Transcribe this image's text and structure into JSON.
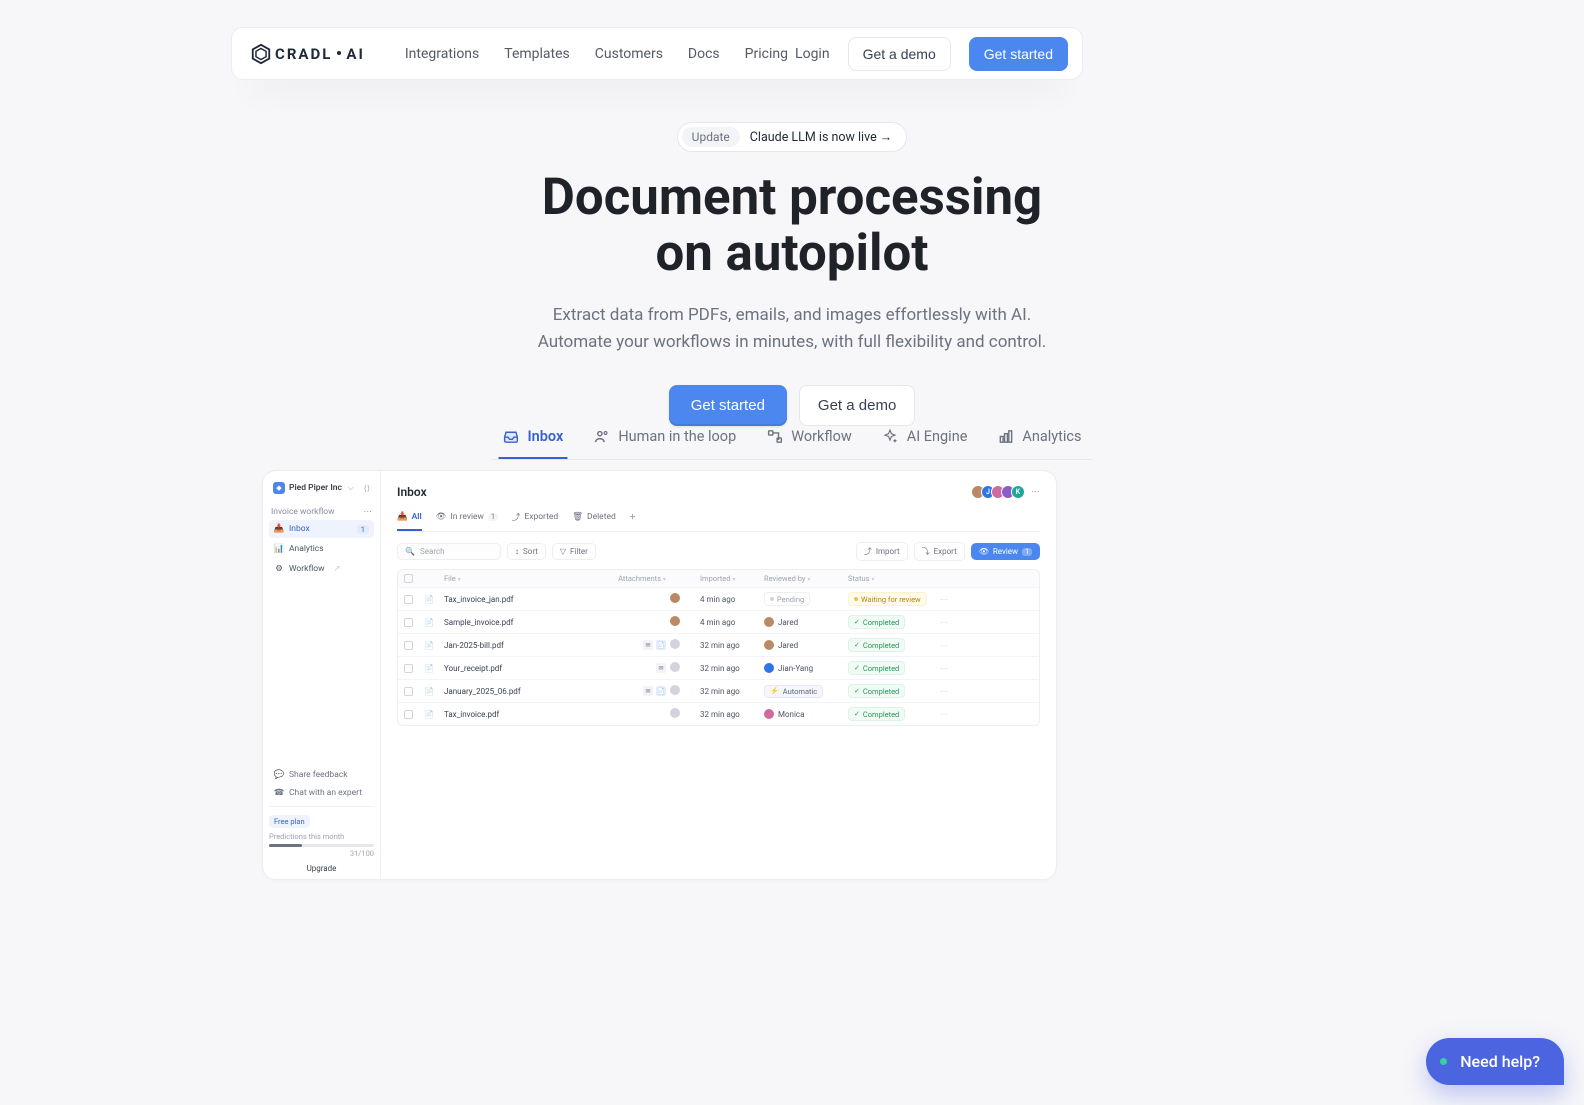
{
  "nav": {
    "brand_a": "CRADL",
    "brand_b": "AI",
    "links": [
      "Integrations",
      "Templates",
      "Customers",
      "Docs",
      "Pricing"
    ],
    "login": "Login",
    "demo": "Get a demo",
    "start": "Get started"
  },
  "update": {
    "badge": "Update",
    "text": "Claude LLM is now live →"
  },
  "hero": {
    "title_a": "Document processing",
    "title_b": "on autopilot",
    "sub_a": "Extract data from PDFs, emails, and images effortlessly with AI.",
    "sub_b": "Automate your workflows in minutes, with full flexibility and control.",
    "cta_primary": "Get started",
    "cta_secondary": "Get a demo"
  },
  "feature_tabs": [
    "Inbox",
    "Human in the loop",
    "Workflow",
    "AI Engine",
    "Analytics"
  ],
  "app": {
    "org": "Pied Piper Inc",
    "section": "Invoice workflow",
    "items": [
      {
        "label": "Inbox",
        "badge": "1",
        "active": true
      },
      {
        "label": "Analytics"
      },
      {
        "label": "Workflow"
      }
    ],
    "foot": [
      {
        "label": "Share feedback"
      },
      {
        "label": "Chat with an expert"
      }
    ],
    "plan": {
      "pill": "Free plan",
      "label": "Predictions this month",
      "count": "31/100",
      "upgrade": "Upgrade"
    },
    "main": {
      "title": "Inbox",
      "avatars": [
        {
          "bg": "#b98a65",
          "t": ""
        },
        {
          "bg": "#2f74e8",
          "t": "J"
        },
        {
          "bg": "#cf6aa0",
          "t": ""
        },
        {
          "bg": "#8c5cc9",
          "t": ""
        },
        {
          "bg": "#1fa796",
          "t": "K"
        }
      ],
      "tabs": [
        {
          "label": "All",
          "active": true
        },
        {
          "label": "In review",
          "count": "1"
        },
        {
          "label": "Exported"
        },
        {
          "label": "Deleted"
        }
      ],
      "search_ph": "Search",
      "sort": "Sort",
      "filter": "Filter",
      "import": "Import",
      "export": "Export",
      "review": "Review",
      "review_count": "1",
      "cols": {
        "file": "File",
        "attachments": "Attachments",
        "imported": "Imported",
        "reviewed": "Reviewed by",
        "status": "Status"
      },
      "rows": [
        {
          "file": "Tax_invoice_jan.pdf",
          "att": [],
          "imp_av": "#b98a65",
          "imp": "4 min ago",
          "rev": "Pending",
          "rev_type": "pending",
          "status": "Waiting for review",
          "status_type": "waiting"
        },
        {
          "file": "Sample_invoice.pdf",
          "att": [],
          "imp_av": "#b98a65",
          "imp": "4 min ago",
          "rev": "Jared",
          "rev_type": "user",
          "rev_av": "#b98a65",
          "status": "Completed",
          "status_type": "completed"
        },
        {
          "file": "Jan-2025-bill.pdf",
          "att": [
            "mail",
            "doc"
          ],
          "imp_av": "#d1d5db",
          "imp": "32 min ago",
          "rev": "Jared",
          "rev_type": "user",
          "rev_av": "#b98a65",
          "status": "Completed",
          "status_type": "completed"
        },
        {
          "file": "Your_receipt.pdf",
          "att": [
            "mail"
          ],
          "imp_av": "#d1d5db",
          "imp": "32 min ago",
          "rev": "Jian-Yang",
          "rev_type": "user",
          "rev_av": "#2f74e8",
          "status": "Completed",
          "status_type": "completed"
        },
        {
          "file": "January_2025_06.pdf",
          "att": [
            "mail",
            "doc"
          ],
          "imp_av": "#d1d5db",
          "imp": "32 min ago",
          "rev": "Automatic",
          "rev_type": "automatic",
          "status": "Completed",
          "status_type": "completed"
        },
        {
          "file": "Tax_invoice.pdf",
          "att": [],
          "imp_av": "#d1d5db",
          "imp": "32 min ago",
          "rev": "Monica",
          "rev_type": "user",
          "rev_av": "#cf6aa0",
          "status": "Completed",
          "status_type": "completed"
        }
      ]
    }
  },
  "help": "Need help?"
}
